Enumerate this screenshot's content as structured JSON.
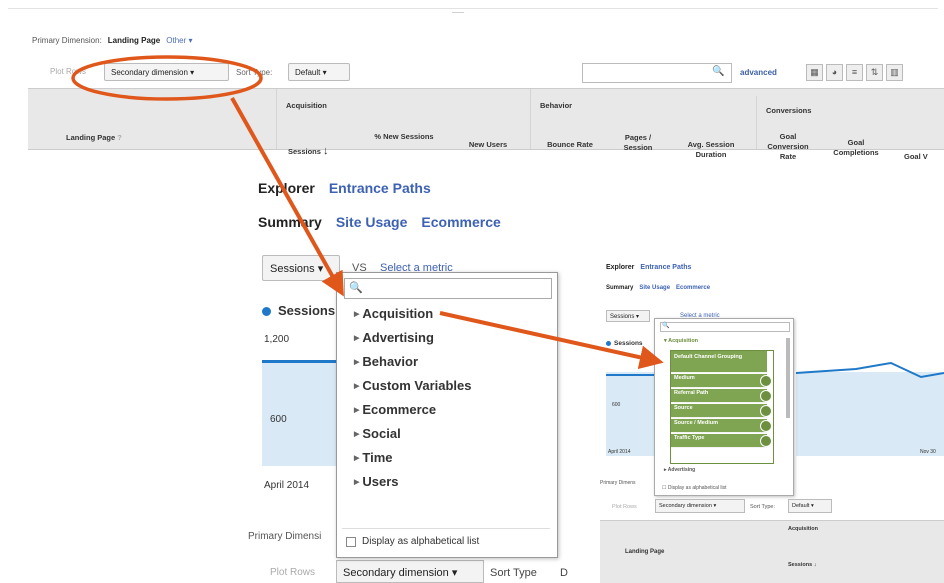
{
  "top": {
    "center_label": "——",
    "primary_dimension_label": "Primary Dimension:",
    "primary_dimension_value": "Landing Page",
    "other_label": "Other ▾",
    "plot_rows": "Plot Rows",
    "secondary_dimension": "Secondary dimension",
    "sort_type": "Sort Type:",
    "default_value": "Default",
    "advanced": "advanced",
    "columns": {
      "landing_page": "Landing Page",
      "acquisition": "Acquisition",
      "behavior": "Behavior",
      "conversions": "Conversions",
      "sessions": "Sessions",
      "pct_new_sessions": "% New Sessions",
      "new_users": "New Users",
      "bounce_rate": "Bounce Rate",
      "pages_session": "Pages / Session",
      "avg_session_duration": "Avg. Session Duration",
      "goal_conversion_rate": "Goal Conversion Rate",
      "goal_completions": "Goal Completions",
      "goal_value": "Goal V"
    }
  },
  "center": {
    "tabs": [
      "Explorer",
      "Entrance Paths"
    ],
    "subtabs": [
      "Summary",
      "Site Usage",
      "Ecommerce"
    ],
    "metric_select": "Sessions",
    "vs_label": "VS",
    "select_metric": "Select a metric",
    "legend": "Sessions",
    "y_high": "1,200",
    "y_mid": "600",
    "x_start": "April 2014",
    "primary_dimension_cut": "Primary Dimensi",
    "plot_rows": "Plot Rows",
    "secondary_dimension": "Secondary dimension",
    "sort_type": "Sort Type",
    "cut_letter": "D"
  },
  "dropdown": {
    "search_icon": "🔍",
    "items": [
      "Acquisition",
      "Advertising",
      "Behavior",
      "Custom Variables",
      "Ecommerce",
      "Social",
      "Time",
      "Users"
    ],
    "alphabetical": "Display as alphabetical list"
  },
  "right": {
    "tabs": [
      "Explorer",
      "Entrance Paths"
    ],
    "subtabs": [
      "Summary",
      "Site Usage",
      "Ecommerce"
    ],
    "metric_select": "Sessions",
    "select_metric": "Select a metric",
    "legend": "Sessions",
    "y_mid": "600",
    "x_start": "April 2014",
    "x_end": "Nov 30",
    "primary_dimension_cut": "Primary Dimens",
    "acquisition_header": "Acquisition",
    "green_items": [
      "Default Channel Grouping",
      "Medium",
      "Referral Path",
      "Source",
      "Source / Medium",
      "Traffic Type"
    ],
    "advertising": "Advertising",
    "alphabetical": "Display as alphabetical list",
    "plot_rows": "Plot Rows",
    "secondary_dimension": "Secondary dimension",
    "sort_type": "Sort Type:",
    "default_value": "Default",
    "acq_group": "Acquisition",
    "landing_page": "Landing Page",
    "sessions": "Sessions"
  },
  "colors": {
    "annotation_orange": "#e0571c",
    "ga_blue": "#1f78c8",
    "link_blue": "#3d62b4",
    "green": "#7fa452"
  }
}
